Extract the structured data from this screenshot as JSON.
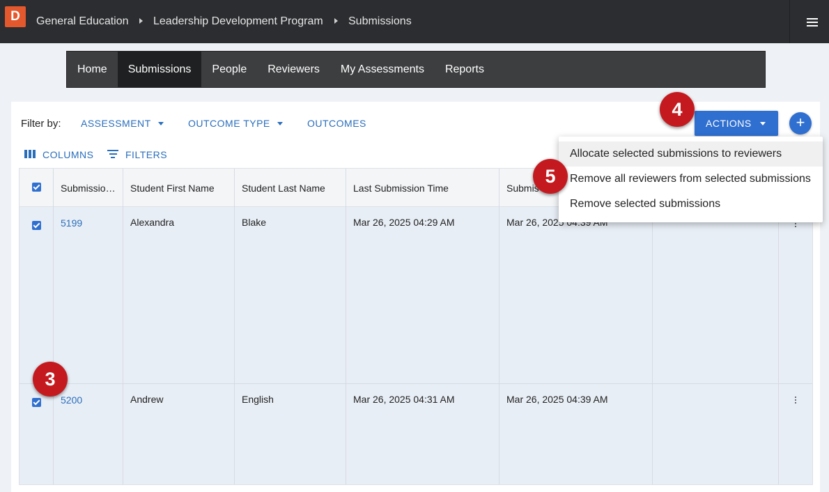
{
  "app": {
    "logo_letter": "D"
  },
  "breadcrumb": [
    {
      "label": "General Education"
    },
    {
      "label": "Leadership Development Program"
    },
    {
      "label": "Submissions"
    }
  ],
  "nav": {
    "items": [
      {
        "label": "Home"
      },
      {
        "label": "Submissions",
        "active": true
      },
      {
        "label": "People"
      },
      {
        "label": "Reviewers"
      },
      {
        "label": "My Assessments"
      },
      {
        "label": "Reports"
      }
    ]
  },
  "filter": {
    "label": "Filter by:",
    "assessment": "ASSESSMENT",
    "outcome_type": "OUTCOME TYPE",
    "outcomes": "OUTCOMES"
  },
  "toolbar": {
    "columns": "COLUMNS",
    "filters": "FILTERS"
  },
  "actions": {
    "label": "ACTIONS",
    "add_symbol": "+"
  },
  "actions_menu": {
    "items": [
      {
        "label": "Allocate selected submissions to reviewers"
      },
      {
        "label": "Remove all reviewers from selected submissions"
      },
      {
        "label": "Remove selected submissions"
      }
    ]
  },
  "table": {
    "headers": [
      "Submissio…",
      "Student First Name",
      "Student Last Name",
      "Last Submission Time",
      "Submis"
    ],
    "rows": [
      {
        "id": "5199",
        "first": "Alexandra",
        "last": "Blake",
        "last_submission": "Mar 26, 2025 04:29 AM",
        "submission": "Mar 26, 2025 04:39 AM",
        "checked": true
      },
      {
        "id": "5200",
        "first": "Andrew",
        "last": "English",
        "last_submission": "Mar 26, 2025 04:31 AM",
        "submission": "Mar 26, 2025 04:39 AM",
        "checked": true
      }
    ]
  },
  "steps": {
    "s3": "3",
    "s4": "4",
    "s5": "5"
  },
  "colors": {
    "accent": "#2f6fd0",
    "badge": "#c41a1f",
    "logo": "#e4582d",
    "topbar": "#2b2d30"
  }
}
